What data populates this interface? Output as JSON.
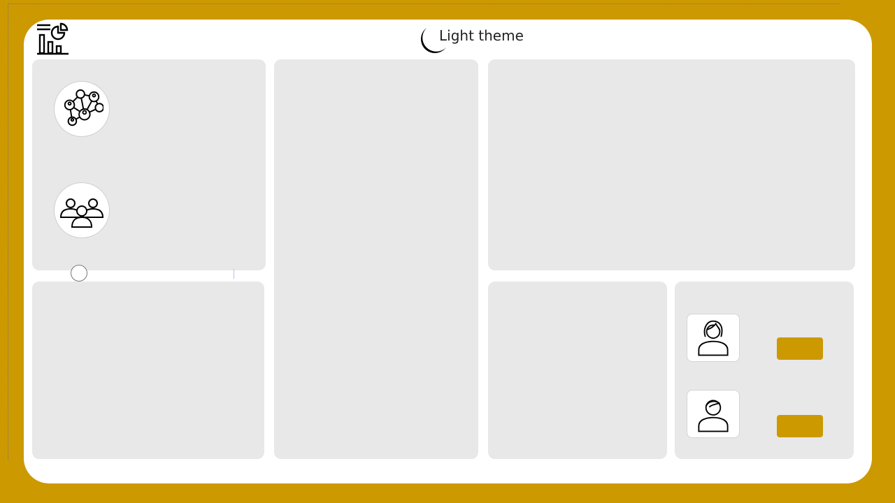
{
  "header": {
    "logo_icon": "dashboard-chart-icon",
    "theme_toggle": {
      "icon": "moon-icon",
      "label": "Light theme"
    }
  },
  "panels": {
    "left_top": {
      "icons": [
        "network-people-icon",
        "team-group-icon"
      ]
    },
    "contacts": [
      {
        "avatar_icon": "female-user-icon",
        "button_label": ""
      },
      {
        "avatar_icon": "male-user-icon",
        "button_label": ""
      }
    ]
  },
  "colors": {
    "accent": "#CC9900",
    "panel": "#E8E8E8",
    "surface": "#FFFFFF"
  }
}
